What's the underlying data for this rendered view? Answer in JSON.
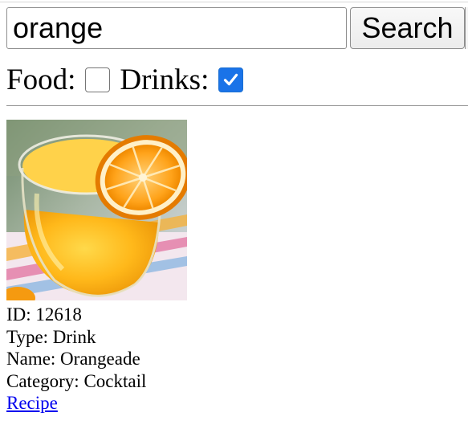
{
  "search": {
    "value": "orange",
    "button_label": "Search"
  },
  "filters": {
    "food_label": "Food:",
    "food_checked": false,
    "drinks_label": "Drinks:",
    "drinks_checked": true
  },
  "results": [
    {
      "image_icon": "orange-cocktail-photo",
      "id_line": "ID: 12618",
      "type_line": "Type: Drink",
      "name_line": "Name: Orangeade",
      "category_line": "Category: Cocktail",
      "link_label": "Recipe"
    }
  ],
  "colors": {
    "checkbox_accent": "#1a73e8",
    "link": "#0000ee"
  }
}
